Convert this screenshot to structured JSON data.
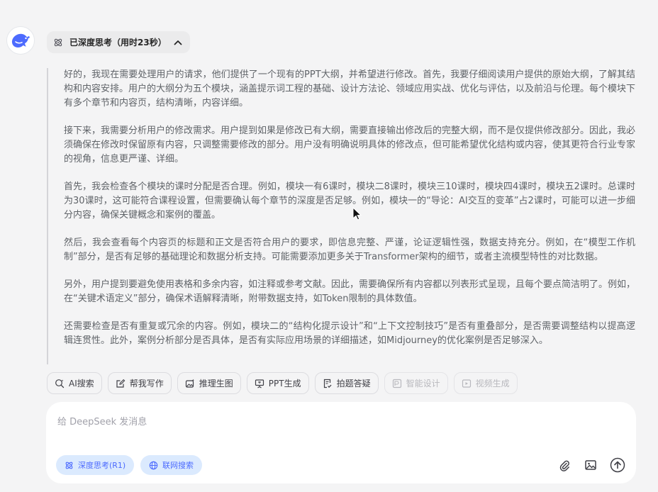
{
  "thinking": {
    "label": "已深度思考（用时23秒）",
    "paragraphs": [
      "好的，我现在需要处理用户的请求，他们提供了一个现有的PPT大纲，并希望进行修改。首先，我要仔细阅读用户提供的原始大纲，了解其结构和内容安排。用户的大纲分为五个模块，涵盖提示词工程的基础、设计方法论、领域应用实战、优化与评估，以及前沿与伦理。每个模块下有多个章节和内容页，结构清晰，内容详细。",
      "接下来，我需要分析用户的修改需求。用户提到如果是修改已有大纲，需要直接输出修改后的完整大纲，而不是仅提供修改部分。因此，我必须确保在修改时保留原有内容，只调整需要修改的部分。用户没有明确说明具体的修改点，但可能希望优化结构或内容，使其更符合行业专家的视角，信息更严谨、详细。",
      "首先，我会检查各个模块的课时分配是否合理。例如，模块一有6课时，模块二8课时，模块三10课时，模块四4课时，模块五2课时。总课时为30课时，这可能符合课程设置，但需要确认每个章节的深度是否足够。例如，模块一的“导论：AI交互的变革”占2课时，可能可以进一步细分内容，确保关键概念和案例的覆盖。",
      "然后，我会查看每个内容页的标题和正文是否符合用户的要求，即信息完整、严谨，论证逻辑性强，数据支持充分。例如，在“模型工作机制”部分，是否有足够的基础理论和数据分析支持。可能需要添加更多关于Transformer架构的细节，或者主流模型特性的对比数据。",
      "另外，用户提到要避免使用表格和多余内容，如注释或参考文献。因此，需要确保所有内容都以列表形式呈现，且每个要点简洁明了。例如，在“关键术语定义”部分，确保术语解释清晰，附带数据支持，如Token限制的具体数值。",
      "还需要检查是否有重复或冗余的内容。例如，模块二的“结构化提示设计”和“上下文控制技巧”是否有重叠部分，是否需要调整结构以提高逻辑连贯性。此外，案例分析部分是否具体，是否有实际应用场景的详细描述，如Midjourney的优化案例是否足够深入。"
    ]
  },
  "tools": [
    {
      "label": "AI搜索",
      "icon": "search-sparkle-icon",
      "disabled": false
    },
    {
      "label": "帮我写作",
      "icon": "edit-icon",
      "disabled": false
    },
    {
      "label": "推理生图",
      "icon": "image-sparkle-icon",
      "disabled": false
    },
    {
      "label": "PPT生成",
      "icon": "presentation-icon",
      "disabled": false
    },
    {
      "label": "拍题答疑",
      "icon": "document-check-icon",
      "disabled": false
    },
    {
      "label": "智能设计",
      "icon": "design-icon",
      "disabled": true
    },
    {
      "label": "视频生成",
      "icon": "video-icon",
      "disabled": true
    }
  ],
  "composer": {
    "placeholder": "给 DeepSeek 发消息",
    "value": "",
    "deep_think_label": "深度思考(R1)",
    "web_search_label": "联网搜索"
  },
  "colors": {
    "brand": "#4d6bfe",
    "pill_bg": "#dbeafe",
    "background": "#f4f4f5"
  }
}
